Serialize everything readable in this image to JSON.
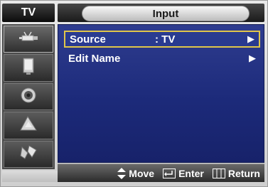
{
  "header": {
    "mode_label": "TV",
    "title": "Input"
  },
  "sidebar": {
    "items": [
      {
        "icon": "antenna-icon",
        "active": true
      },
      {
        "icon": "picture-icon",
        "active": false
      },
      {
        "icon": "speaker-icon",
        "active": false
      },
      {
        "icon": "clock-icon",
        "active": false
      },
      {
        "icon": "setup-icon",
        "active": false
      }
    ]
  },
  "menu": {
    "rows": [
      {
        "label": "Source",
        "value": ": TV",
        "arrow": "▶",
        "selected": true
      },
      {
        "label": "Edit Name",
        "value": "",
        "arrow": "▶",
        "selected": false
      }
    ]
  },
  "help": {
    "move_label": "Move",
    "enter_label": "Enter",
    "return_label": "Return"
  },
  "colors": {
    "panel_blue": "#1c2a7a",
    "selection_border": "#e0c64a"
  }
}
